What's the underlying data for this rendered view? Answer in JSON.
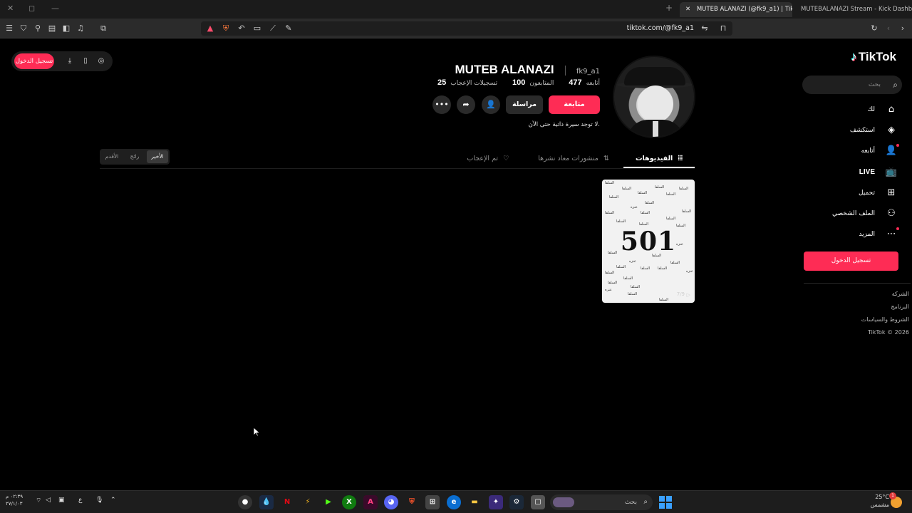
{
  "browser": {
    "tabs": [
      {
        "title": "MUTEB ALANAZI (@fk9_a1) | TikTok",
        "active": true
      },
      {
        "title": "MUTEBALANAZI Stream - Kick Dashb",
        "active": false
      }
    ],
    "url": "tiktok.com/@fk9_a1",
    "new_tab_symbol": "+",
    "close_symbol": "✕"
  },
  "sidebar": {
    "logo": "TikTok",
    "search_placeholder": "بحث",
    "items": [
      {
        "label": "لك",
        "icon": "home-icon"
      },
      {
        "label": "استكشف",
        "icon": "compass-icon"
      },
      {
        "label": "أتابعه",
        "icon": "following-icon",
        "dot": true
      },
      {
        "label": "LIVE",
        "icon": "live-icon"
      },
      {
        "label": "تحميل",
        "icon": "upload-icon"
      },
      {
        "label": "الملف الشخصي",
        "icon": "profile-icon"
      },
      {
        "label": "المزيد",
        "icon": "more-icon",
        "dot": true
      }
    ],
    "login_button": "تسجيل الدخول",
    "footer": [
      "الشركة",
      "البرنامج",
      "الشروط والسياسات",
      "TikTok © 2026"
    ]
  },
  "topleft": {
    "login_button": "تسجيل الدخول"
  },
  "profile": {
    "display_name": "MUTEB ALANAZI",
    "username": "fk9_a1",
    "stats": [
      {
        "value": "477",
        "label": "أتابعه"
      },
      {
        "value": "100",
        "label": "المتابعون"
      },
      {
        "value": "25",
        "label": "تسجيلات الإعجاب"
      }
    ],
    "follow_button": "متابعة",
    "message_button": "مراسلة",
    "bio": "لا توجد سيرة ذاتية حتى الآن."
  },
  "content_tabs": [
    {
      "label": "الفيديوهات",
      "active": true
    },
    {
      "label": "منشورات معاد نشرها",
      "active": false
    },
    {
      "label": "تم الإعجاب",
      "active": false
    }
  ],
  "sort_options": [
    {
      "label": "الأخير",
      "selected": true
    },
    {
      "label": "رائج",
      "selected": false
    },
    {
      "label": "الأقدم",
      "selected": false
    }
  ],
  "videos": [
    {
      "overlay_text": "501",
      "watermark_words": [
        "السلفا",
        "عنزه"
      ],
      "views": "7/9"
    }
  ],
  "taskbar": {
    "search_placeholder": "بحث",
    "time": "٠٢:٣٩ م",
    "date": "٢٧/١/٠٣",
    "weather_temp": "25°C",
    "weather_desc": "مشمس",
    "notification_count": "1"
  },
  "colors": {
    "accent": "#fe2c55",
    "background": "#000000",
    "surface": "#2a2a2a"
  }
}
